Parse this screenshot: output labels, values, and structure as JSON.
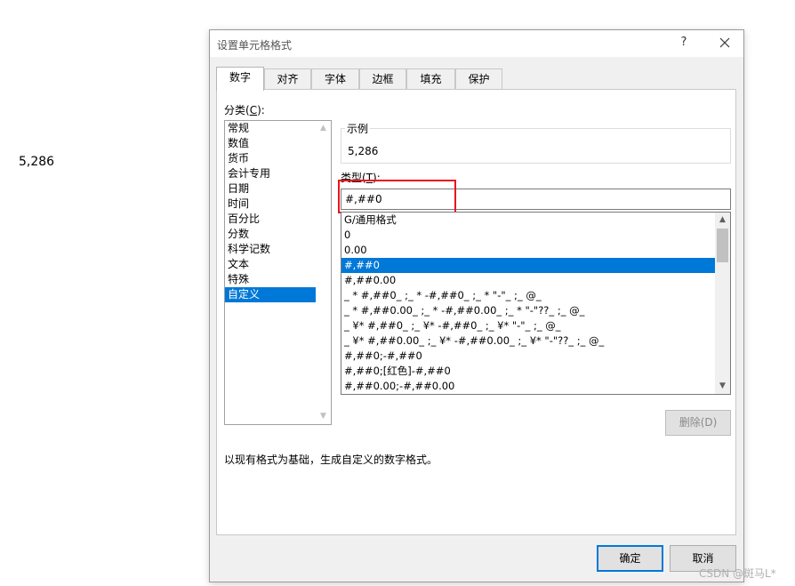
{
  "cell_value": "5,286",
  "dialog": {
    "title": "设置单元格格式",
    "help": "?",
    "tabs": [
      "数字",
      "对齐",
      "字体",
      "边框",
      "填充",
      "保护"
    ],
    "active_tab": "数字",
    "category_label_pre": "分类(",
    "category_label_key": "C",
    "category_label_post": "):",
    "categories": [
      "常规",
      "数值",
      "货币",
      "会计专用",
      "日期",
      "时间",
      "百分比",
      "分数",
      "科学记数",
      "文本",
      "特殊",
      "自定义"
    ],
    "selected_category": "自定义",
    "sample_label": "示例",
    "sample_value": "5,286",
    "type_label_pre": "类型(",
    "type_label_key": "T",
    "type_label_post": "):",
    "type_value": "#,##0",
    "formats": [
      "G/通用格式",
      "0",
      "0.00",
      "#,##0",
      "#,##0.00",
      "_ * #,##0_ ;_ * -#,##0_ ;_ * \"-\"_ ;_ @_",
      "_ * #,##0.00_ ;_ * -#,##0.00_ ;_ * \"-\"??_ ;_ @_",
      "_ ¥* #,##0_ ;_ ¥* -#,##0_ ;_ ¥* \"-\"_ ;_ @_",
      "_ ¥* #,##0.00_ ;_ ¥* -#,##0.00_ ;_ ¥* \"-\"??_ ;_ @_",
      "#,##0;-#,##0",
      "#,##0;[红色]-#,##0",
      "#,##0.00;-#,##0.00"
    ],
    "selected_format": "#,##0",
    "delete_button": "删除(D)",
    "description": "以现有格式为基础，生成自定义的数字格式。",
    "ok_button": "确定",
    "cancel_button": "取消"
  },
  "watermark": "CSDN @斑马L*",
  "colors": {
    "accent": "#0078d7",
    "highlight_box": "#e8161b"
  }
}
